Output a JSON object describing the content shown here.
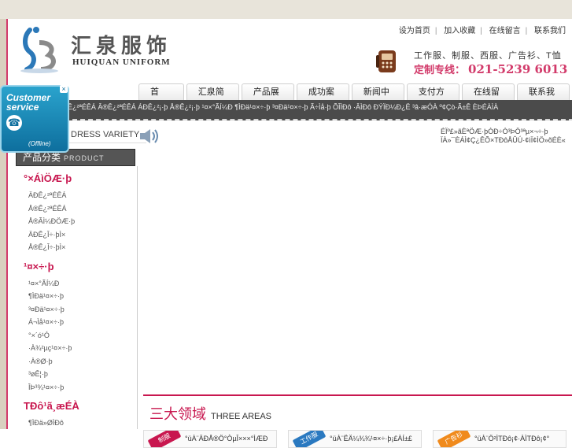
{
  "header": {
    "logo_cn": "汇泉服饰",
    "logo_en": "HUIQUAN UNIFORM",
    "top_links": [
      "设为首页",
      "加入收藏",
      "在线留言",
      "联系我们"
    ],
    "services": "工作服、制服、西服、广告衫、T恤",
    "hotline_label": "定制专线：",
    "hotline_number": "021-5239 6013"
  },
  "nav": [
    "首　页",
    "汇泉简介",
    "产品展示",
    "成功案例",
    "新闻中心",
    "支付方式",
    "在线留言",
    "联系我们"
  ],
  "ticker": "Ê¿²ªÉÊÁ Â®Ê¿²ªÉÊÁ ÁÐÊ¿²¡·þ Å®Ê¿²¡·þ ¹¤×°ÃÍ¼Ð ¶ÌÐä¹¤×÷·þ ³¤Ðä¹¤×÷·þ Ã÷Ìå·þ ÕÎÌÐô ·ÂÌÐô ÐÝÏÐ¼Ð¿Ë ³â·æÓÀ º¢Çò·Ã±Ê ÈÞÉÀÌÀ",
  "dress_variety": "DRESS VARIETY",
  "marquee": [
    "ÉÏº£»ãÈªÖÆ·þÓÐ÷Ó³ÞÖ³ªµ×¬÷·þ",
    "ÏÀ»¯ÈÁÌ¢Ç¿ÊÕ×TÐôÅÛÚ·¢ìÏ¢ÌÖ»õÉÈ«"
  ],
  "customer_service": {
    "title_1": "Customer",
    "title_2": "service",
    "status": "(Offline)",
    "close": "×"
  },
  "sidebar": {
    "heading": "产品分类",
    "heading_en": "PRODUCT",
    "categories": [
      {
        "title": "°×ÁìÖÆ·þ",
        "items": [
          "ÄÐÊ¿²ªÉÊÁ",
          "Å®Ê¿²ªÉÊÁ",
          "Å®ÃÌ¼ÐÖÆ·þ",
          "ÄÐÊ¿Î÷·þÌ×",
          "Å®Ê¿Î÷·þÌ×"
        ]
      },
      {
        "title": "¹¤×÷·þ",
        "items": [
          "¹¤×°ÃÍ¼Ð",
          "¶ÌÐä¹¤×÷·þ",
          "³¤Ðä¹¤×÷·þ",
          "Á¬Ìå¹¤×÷·þ",
          "°×´ó¹Ó",
          "·À¾²µç¹¤×÷·þ",
          "·À®Ø·þ",
          "³øÊ¦·þ",
          "ÎÞ³¾¹¤×÷·þ"
        ]
      },
      {
        "title": "TÐô¹ã¸æÉÀ",
        "items": [
          "¶ÌÐä»ØÌÐô"
        ]
      }
    ]
  },
  "areas": {
    "title": "三大领域",
    "title_en": "THREE AREAS",
    "cards": [
      {
        "ribbon": "制服",
        "text": "°üÀ¨ÄÐÅ®Ö°ÒµÎ×××°ÌÆÐ",
        "color": "#c8174f"
      },
      {
        "ribbon": "工作服",
        "text": "°üÀ¨ËÄ¼¾¾¹¤×÷·þ¡£ÀÍ±£",
        "color": "#2a79c0"
      },
      {
        "ribbon": "广告衫",
        "text": "°üÀ¨Ö²ÌTÐô¡¢·ÀÌTÐô¡¢°",
        "color": "#f08a1c"
      }
    ]
  },
  "colors": {
    "accent": "#c8174f",
    "nav_bg": "#ececec",
    "ticker_bg": "#4b4b4b"
  }
}
